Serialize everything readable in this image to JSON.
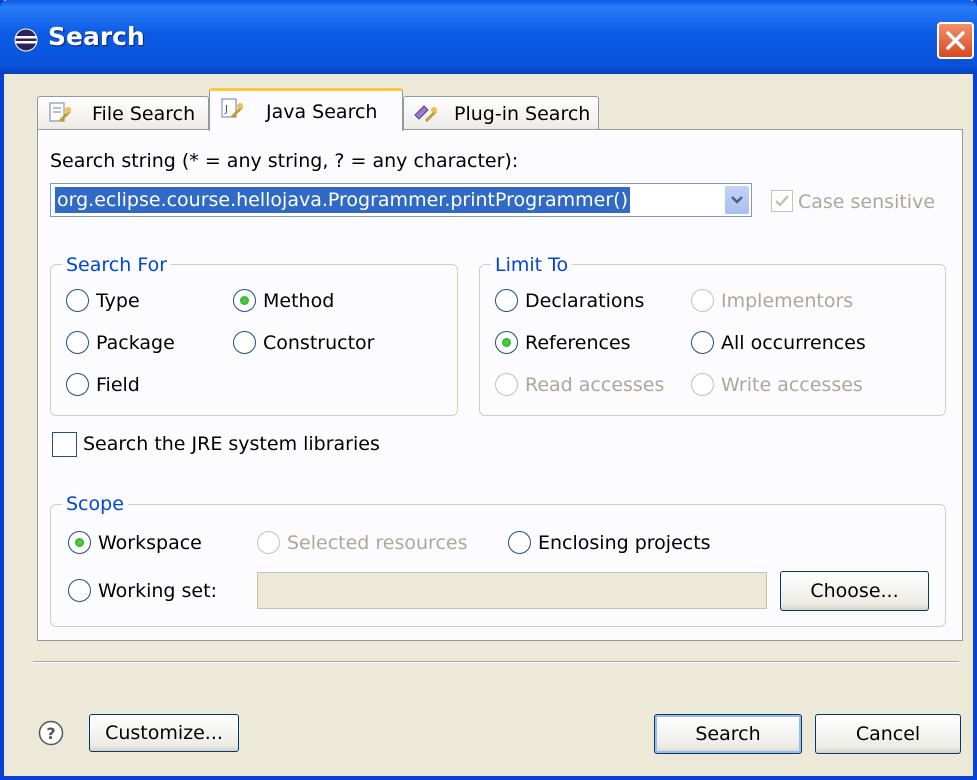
{
  "window": {
    "title": "Search"
  },
  "tabs": [
    {
      "label": "File Search"
    },
    {
      "label": "Java Search"
    },
    {
      "label": "Plug-in Search"
    }
  ],
  "search_string": {
    "label": "Search string (* = any string, ? = any character):",
    "value": "org.eclipse.course.hellojava.Programmer.printProgrammer()",
    "case_sensitive": {
      "label": "Case sensitive",
      "checked": true,
      "enabled": false
    }
  },
  "search_for": {
    "title": "Search For",
    "options": [
      {
        "label": "Type",
        "selected": false
      },
      {
        "label": "Method",
        "selected": true
      },
      {
        "label": "Package",
        "selected": false
      },
      {
        "label": "Constructor",
        "selected": false
      },
      {
        "label": "Field",
        "selected": false
      }
    ]
  },
  "limit_to": {
    "title": "Limit To",
    "options": [
      {
        "label": "Declarations",
        "selected": false,
        "enabled": true
      },
      {
        "label": "Implementors",
        "selected": false,
        "enabled": false
      },
      {
        "label": "References",
        "selected": true,
        "enabled": true
      },
      {
        "label": "All occurrences",
        "selected": false,
        "enabled": true
      },
      {
        "label": "Read accesses",
        "selected": false,
        "enabled": false
      },
      {
        "label": "Write accesses",
        "selected": false,
        "enabled": false
      }
    ]
  },
  "jre_checkbox": {
    "label": "Search the JRE system libraries",
    "checked": false
  },
  "scope": {
    "title": "Scope",
    "options": [
      {
        "label": "Workspace",
        "selected": true,
        "enabled": true
      },
      {
        "label": "Selected resources",
        "selected": false,
        "enabled": false
      },
      {
        "label": "Enclosing projects",
        "selected": false,
        "enabled": true
      },
      {
        "label": "Working set:",
        "selected": false,
        "enabled": true
      }
    ],
    "working_set_value": "",
    "choose_label": "Choose..."
  },
  "footer": {
    "customize_label": "Customize...",
    "search_label": "Search",
    "cancel_label": "Cancel"
  },
  "colors": {
    "title_bar": "#0A5BEA",
    "accent_blue": "#0046D5",
    "selection": "#316AC5",
    "dialog_bg": "#ECE9D8"
  }
}
